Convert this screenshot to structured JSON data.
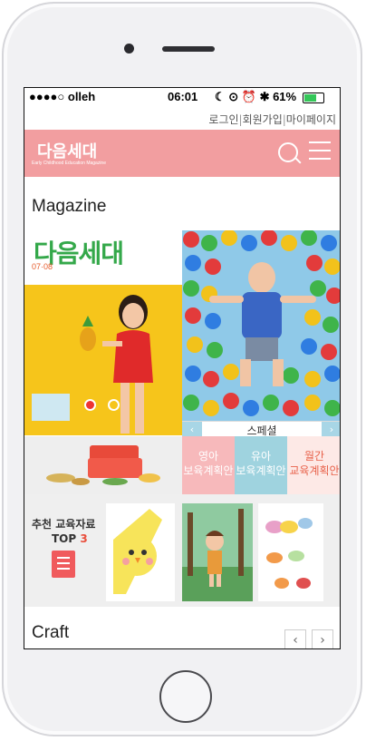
{
  "status_bar": {
    "carrier": "●●●●○ olleh",
    "time": "06:01",
    "battery": "61%"
  },
  "top_links": {
    "login": "로그인",
    "join": "회원가입",
    "mypage": "마이페이지"
  },
  "header": {
    "logo": "다음세대",
    "logo_sub": "Early Childhood Education Magazine"
  },
  "magazine": {
    "title": "Magazine",
    "cover_title": "다음세대",
    "cover_date": "07·08",
    "special_label": "스페셜",
    "tiles": [
      {
        "line1": "영아",
        "line2": "보육계획안"
      },
      {
        "line1": "유아",
        "line2": "보육계획안"
      },
      {
        "line1": "월간",
        "line2": "교육계획안"
      }
    ]
  },
  "recommend": {
    "line1": "추천 교육자료",
    "top": "TOP",
    "num": "3"
  },
  "craft": {
    "title": "Craft"
  },
  "colors": {
    "brand_pink": "#f29ea0",
    "tile_pink": "#f7b9bb",
    "tile_blue": "#9fd3df",
    "tile_light": "#fde9e6"
  }
}
